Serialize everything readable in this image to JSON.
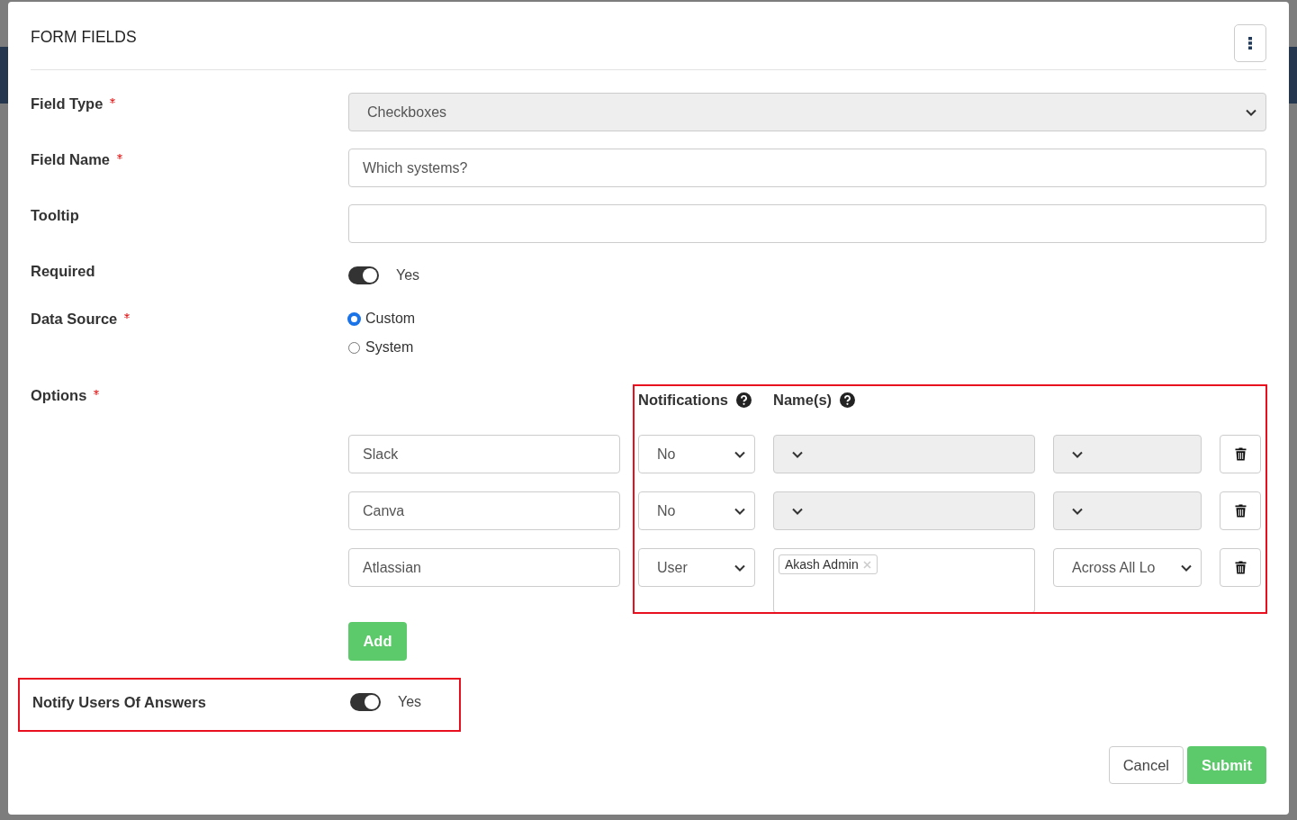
{
  "dialog": {
    "title": "FORM FIELDS"
  },
  "fields": [
    {
      "kind": "select",
      "label": "Field Type",
      "required": true,
      "value": "Checkboxes",
      "disabled": true
    },
    {
      "kind": "text",
      "label": "Field Name",
      "required": true,
      "value": "Which systems?"
    },
    {
      "kind": "text",
      "label": "Tooltip",
      "required": false
    },
    {
      "kind": "toggle",
      "label": "Required",
      "required": false,
      "on": true,
      "text": "Yes"
    },
    {
      "kind": "radio",
      "label": "Data Source",
      "required": true,
      "options": [
        {
          "label": "Custom",
          "selected": true
        },
        {
          "label": "System",
          "selected": false
        }
      ]
    }
  ],
  "options": {
    "label": "Options",
    "required": true,
    "highlighted": true,
    "headers": [
      "Notifications",
      "Name(s)"
    ],
    "rows": [
      {
        "value": "Slack",
        "notification": "No",
        "disabled": true
      },
      {
        "value": "Canva",
        "notification": "No",
        "disabled": true
      },
      {
        "value": "Atlassian",
        "notification": "User",
        "disabled": false,
        "names": [
          "Akash Admin"
        ],
        "scope": "Across All Lo"
      }
    ],
    "add_button": "Add"
  },
  "notify": {
    "label": "Notify Users Of Answers",
    "on": true,
    "text": "Yes",
    "highlighted": true
  },
  "buttons": [
    {
      "kind": "secondary",
      "label": "Cancel"
    },
    {
      "kind": "primary",
      "label": "Submit"
    }
  ]
}
